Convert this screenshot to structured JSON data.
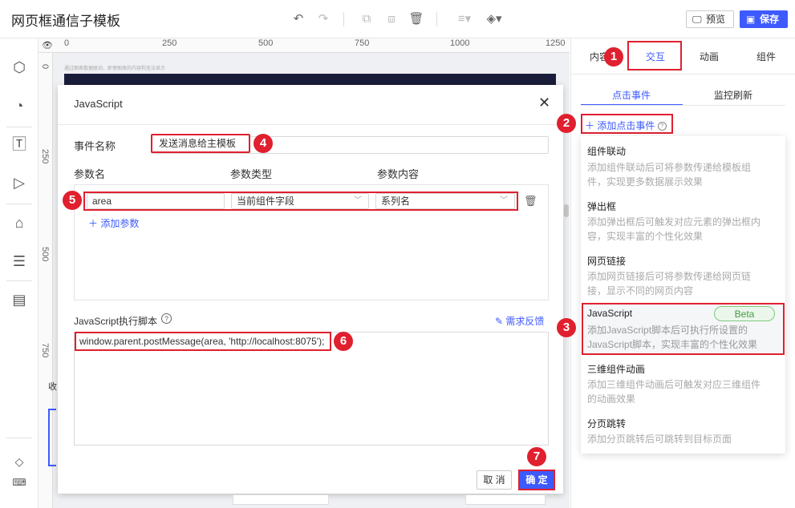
{
  "app": {
    "title": "网页框通信子模板"
  },
  "toolbar": {
    "preview_label": "预览",
    "save_label": "保存"
  },
  "ruler": {
    "top_marks": [
      "0",
      "250",
      "500",
      "750",
      "1000",
      "1250"
    ],
    "left_marks": [
      "0",
      "250",
      "500",
      "750"
    ]
  },
  "canvas": {
    "caption": "通过图表数据联动，即使图表的内容和无法显示",
    "bottom_left_text": "收"
  },
  "modal": {
    "title": "JavaScript",
    "event_name_label": "事件名称",
    "event_name_value": "发送消息给主模板",
    "param_headers": {
      "name": "参数名",
      "type": "参数类型",
      "content": "参数内容"
    },
    "param_row": {
      "name": "area",
      "type": "当前组件字段",
      "content": "系列名"
    },
    "add_param_label": "添加参数",
    "script_label": "JavaScript执行脚本",
    "feedback_label": "需求反馈",
    "script_value": "window.parent.postMessage(area, 'http://localhost:8075');",
    "cancel_label": "取 消",
    "ok_label": "确 定"
  },
  "right_panel": {
    "tabs": [
      "内容",
      "交互",
      "动画",
      "组件"
    ],
    "active_tab": "交互",
    "subtabs": [
      "点击事件",
      "监控刷新"
    ],
    "add_event_label": "添加点击事件",
    "menu": [
      {
        "title": "组件联动",
        "desc": "添加组件联动后可将参数传递给模板组件，实现更多数据展示效果"
      },
      {
        "title": "弹出框",
        "desc": "添加弹出框后可触发对应元素的弹出框内容，实现丰富的个性化效果"
      },
      {
        "title": "网页链接",
        "desc": "添加网页链接后可将参数传递给网页链接，显示不同的网页内容"
      },
      {
        "title": "JavaScript",
        "desc": "添加JavaScript脚本后可执行所设置的JavaScript脚本，实现丰富的个性化效果",
        "badge": "Beta"
      },
      {
        "title": "三维组件动画",
        "desc": "添加三维组件动画后可触发对应三维组件的动画效果"
      },
      {
        "title": "分页跳转",
        "desc": "添加分页跳转后可跳转到目标页面"
      }
    ]
  },
  "callouts": [
    "1",
    "2",
    "3",
    "4",
    "5",
    "6",
    "7"
  ],
  "colors": {
    "accent": "#3d5afe",
    "highlight": "#e0202f",
    "beta_green": "#4a9a4a"
  }
}
